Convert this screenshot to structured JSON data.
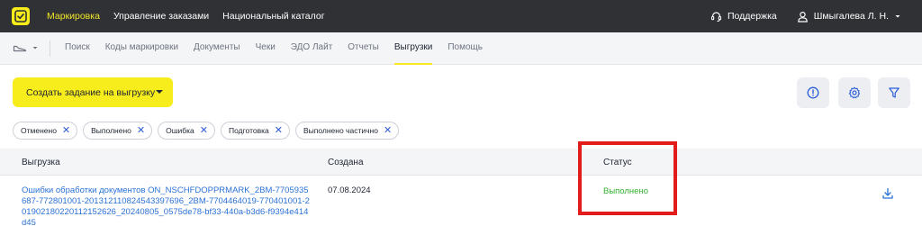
{
  "topbar": {
    "nav": [
      "Маркировка",
      "Управление заказами",
      "Национальный каталог"
    ],
    "support_label": "Поддержка",
    "user_label": "Шмыгалева Л. Н."
  },
  "subnav": {
    "tabs": [
      "Поиск",
      "Коды маркировки",
      "Документы",
      "Чеки",
      "ЭДО Лайт",
      "Отчеты",
      "Выгрузки",
      "Помощь"
    ],
    "active_tab": "Выгрузки"
  },
  "actions": {
    "create_label": "Создать задание на выгрузку"
  },
  "filters": [
    "Отменено",
    "Выполнено",
    "Ошибка",
    "Подготовка",
    "Выполнено частично"
  ],
  "table": {
    "columns": [
      "Выгрузка",
      "Создана",
      "Статус"
    ],
    "rows": [
      {
        "name": "Ошибки обработки документов ON_NSCHFDOPPRMARK_2BM-7705935687-772801001-201312110824543397696_2BM-7704464019-770401001-201902180220112152626_20240805_0575de78-bf33-440a-b3d6-f9394e414d45",
        "created": "07.08.2024",
        "status": "Выполнено"
      }
    ]
  },
  "colors": {
    "topbar_bg": "#2f3135",
    "accent_yellow": "#f7ec1c",
    "link_blue": "#2b72d6",
    "status_green": "#33b02f",
    "highlight_red": "#e21b1b"
  }
}
